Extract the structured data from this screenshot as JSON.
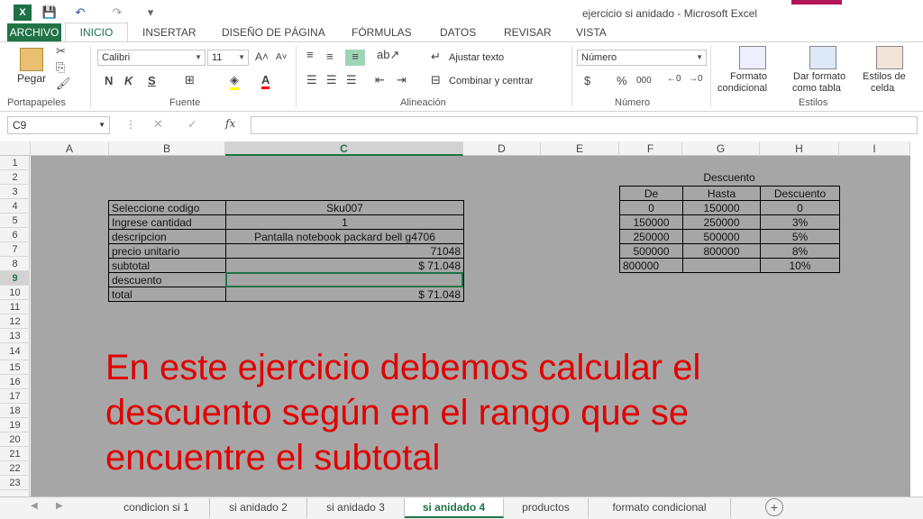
{
  "window": {
    "title": "ejercicio si anidado - Microsoft Excel"
  },
  "quick_access": {
    "app_icon": "X",
    "save": "💾",
    "undo": "↶",
    "redo": "↷",
    "more": "▾"
  },
  "tabs": [
    "ARCHIVO",
    "INICIO",
    "INSERTAR",
    "DISEÑO DE PÁGINA",
    "FÓRMULAS",
    "DATOS",
    "REVISAR",
    "VISTA"
  ],
  "ribbon": {
    "portapapeles": {
      "paste_label": "Pegar",
      "group_label": "Portapapeles"
    },
    "fuente": {
      "font_name": "Calibri",
      "font_size": "11",
      "bold": "N",
      "italic": "K",
      "underline": "S",
      "group_label": "Fuente"
    },
    "alineacion": {
      "wrap_text": "Ajustar texto",
      "merge_center": "Combinar y centrar",
      "group_label": "Alineación"
    },
    "numero": {
      "format": "Número",
      "currency": "$",
      "percent": "%",
      "thousands": "000",
      "group_label": "Número"
    },
    "estilos": {
      "cond_format_1": "Formato",
      "cond_format_2": "condicional",
      "as_table_1": "Dar formato",
      "as_table_2": "como tabla",
      "cell_styles_1": "Estilos de",
      "cell_styles_2": "celda",
      "group_label": "Estilos"
    }
  },
  "formula_bar": {
    "name_box": "C9",
    "fx": "fx",
    "cancel": "✕",
    "enter": "✓"
  },
  "columns": [
    "A",
    "B",
    "C",
    "D",
    "E",
    "F",
    "G",
    "H",
    "I"
  ],
  "rows": [
    "1",
    "2",
    "3",
    "4",
    "5",
    "6",
    "7",
    "8",
    "9",
    "10",
    "11",
    "12",
    "13",
    "14",
    "15",
    "16",
    "17",
    "18",
    "19",
    "20",
    "21",
    "22",
    "23"
  ],
  "main_table": [
    [
      "Seleccione codigo",
      "Sku007"
    ],
    [
      "Ingrese cantidad",
      "1"
    ],
    [
      "descripcion",
      "Pantalla notebook packard bell g4706"
    ],
    [
      "precio unitario",
      "71048"
    ],
    [
      "subtotal",
      "$ 71.048"
    ],
    [
      "descuento",
      ""
    ],
    [
      "total",
      "$ 71.048"
    ]
  ],
  "discount_table": {
    "title": "Descuento",
    "headers": [
      "De",
      "Hasta",
      "Descuento"
    ],
    "rows": [
      [
        "0",
        "150000",
        "0"
      ],
      [
        "150000",
        "250000",
        "3%"
      ],
      [
        "250000",
        "500000",
        "5%"
      ],
      [
        "500000",
        "800000",
        "8%"
      ],
      [
        "800000",
        "",
        "10%"
      ]
    ]
  },
  "overlay_text": "En este ejercicio debemos calcular el descuento según en el rango que se encuentre el subtotal",
  "sheet_tabs": [
    "condicion si 1",
    "si anidado 2",
    "si anidado 3",
    "si anidado 4",
    "productos",
    "formato condicional"
  ],
  "active_sheet": "si anidado 4",
  "colors": {
    "excel_green": "#217346",
    "overlay_red": "#e00000",
    "sheet_bg": "#a6a6a6"
  }
}
